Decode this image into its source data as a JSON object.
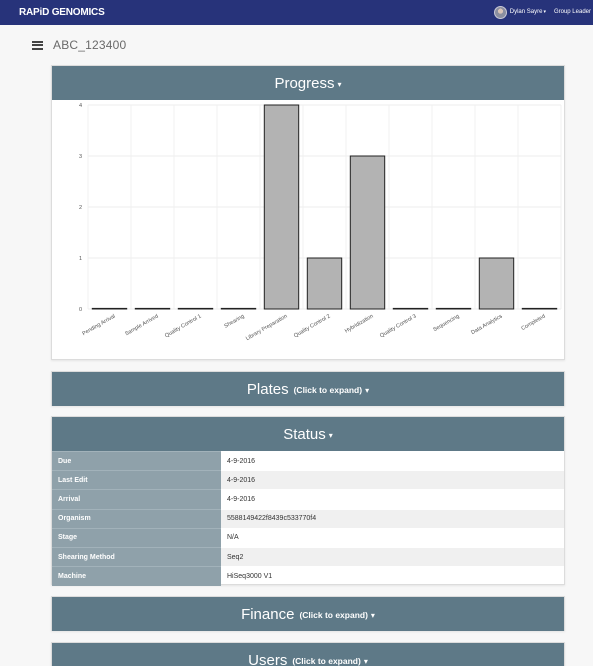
{
  "app": {
    "brand": "RAPiD GENOMICS"
  },
  "user": {
    "name": "Dylan Sayre",
    "role": "Group Leader",
    "caret": "▾"
  },
  "project": {
    "title": "ABC_123400"
  },
  "panels": {
    "progress": {
      "title": "Progress",
      "caret": "▾"
    },
    "plates": {
      "title": "Plates",
      "hint": "(Click to expand)",
      "caret": "▾"
    },
    "status": {
      "title": "Status",
      "caret": "▾"
    },
    "finance": {
      "title": "Finance",
      "hint": "(Click to expand)",
      "caret": "▾"
    },
    "users": {
      "title": "Users",
      "hint": "(Click to expand)",
      "caret": "▾"
    }
  },
  "status_rows": [
    {
      "label": "Due",
      "value": "4-9-2016"
    },
    {
      "label": "Last Edit",
      "value": "4-9-2016"
    },
    {
      "label": "Arrival",
      "value": "4-9-2016"
    },
    {
      "label": "Organism",
      "value": "5588149422f8439c533770f4"
    },
    {
      "label": "Stage",
      "value": "N/A"
    },
    {
      "label": "Shearing Method",
      "value": "Seq2"
    },
    {
      "label": "Machine",
      "value": "HiSeq3000 V1"
    }
  ],
  "colors": {
    "topbar": "#27337a",
    "panel_header": "#5e7987",
    "status_key_bg": "#8fa1aa",
    "bar_fill": "#b3b3b3"
  },
  "chart_data": {
    "type": "bar",
    "categories": [
      "Pending Arrival",
      "Sample Arrived",
      "Quality Control 1",
      "Shearing",
      "Library Preparation",
      "Quality Control 2",
      "Hybridization",
      "Quality Control 3",
      "Sequencing",
      "Data Analytics",
      "Completed"
    ],
    "values": [
      0,
      0,
      0,
      0,
      4,
      1,
      3,
      0,
      0,
      1,
      0
    ],
    "ylim": [
      0,
      4
    ],
    "yticks": [
      0,
      1,
      2,
      3,
      4
    ],
    "grid": true,
    "title": "",
    "xlabel": "",
    "ylabel": ""
  }
}
